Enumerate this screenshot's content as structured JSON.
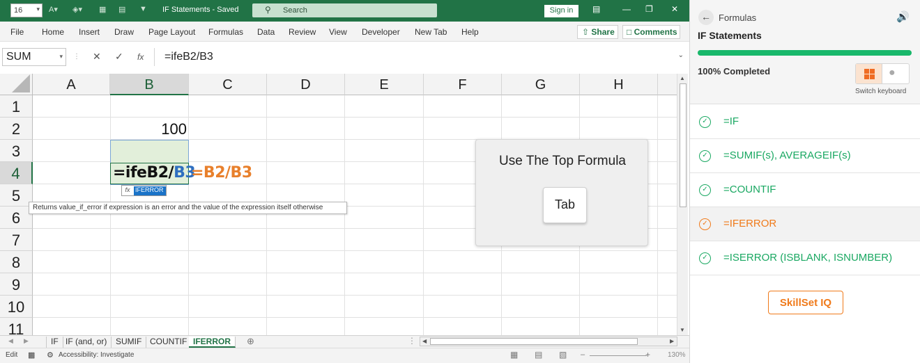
{
  "titlebar": {
    "font_size": "16",
    "doc_title": "IF Statements  -  Saved",
    "search_placeholder": "Search",
    "signin": "Sign in"
  },
  "ribbon": {
    "tabs": [
      "File",
      "Home",
      "Insert",
      "Draw",
      "Page Layout",
      "Formulas",
      "Data",
      "Review",
      "View",
      "Developer",
      "New Tab",
      "Help"
    ],
    "share": "Share",
    "comments": "Comments"
  },
  "formula_bar": {
    "name_box": "SUM",
    "content": "=ifeB2/B3"
  },
  "grid": {
    "columns": [
      "A",
      "B",
      "C",
      "D",
      "E",
      "F",
      "G",
      "H"
    ],
    "rows": [
      "1",
      "2",
      "3",
      "4",
      "5",
      "6",
      "7",
      "8",
      "9",
      "10",
      "11"
    ],
    "b2": "100",
    "b4_prefix": "=ifeB2/",
    "b4_ref": "B3",
    "c4": "=B2/B3",
    "autocomplete_icon": "fx",
    "autocomplete_item": "IFERROR",
    "tooltip": "Returns value_if_error if expression is an error and the value of the expression itself otherwise"
  },
  "overlay": {
    "title": "Use The Top Formula",
    "key": "Tab"
  },
  "sheets": [
    "IF",
    "IF (and, or)",
    "SUMIF",
    "COUNTIF",
    "IFERROR"
  ],
  "statusbar": {
    "mode": "Edit",
    "accessibility": "Accessibility: Investigate",
    "zoom": "130%"
  },
  "panel": {
    "breadcrumb": "Formulas",
    "title": "IF Statements",
    "progress": 1.0,
    "completed": "100% Completed",
    "switch_keyboard": "Switch keyboard",
    "items": [
      {
        "label": "=IF",
        "active": false
      },
      {
        "label": "=SUMIF(s), AVERAGEIF(s)",
        "active": false
      },
      {
        "label": "=COUNTIF",
        "active": false
      },
      {
        "label": "=IFERROR",
        "active": true
      },
      {
        "label": "=ISERROR (ISBLANK, ISNUMBER)",
        "active": false
      }
    ],
    "skillset": "SkillSet IQ"
  },
  "colors": {
    "excel_green": "#217346",
    "progress": "#19b86b",
    "accent_orange": "#f07a1a",
    "ref_blue": "#2e6fc0"
  }
}
